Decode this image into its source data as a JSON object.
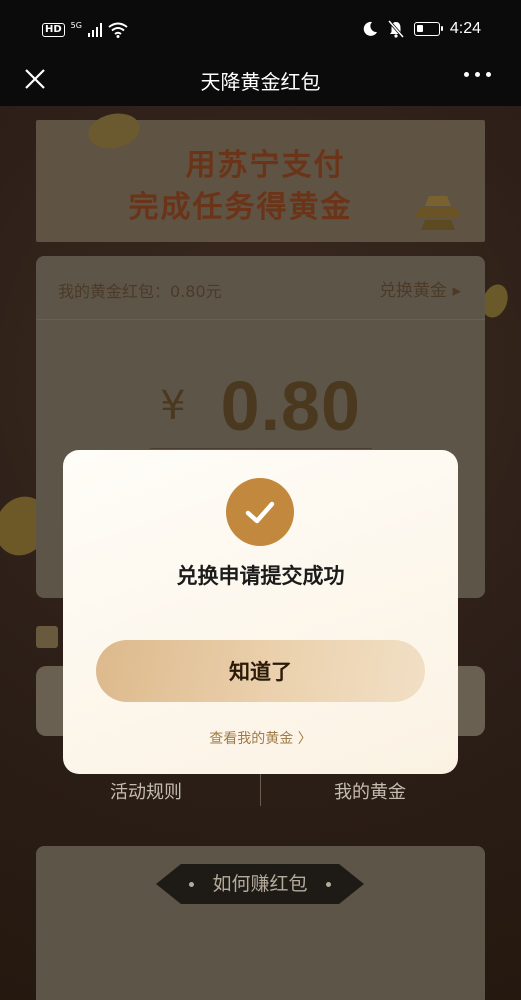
{
  "status_bar": {
    "hd": "HD",
    "network": "5G",
    "time": "4:24"
  },
  "nav": {
    "title": "天降黄金红包"
  },
  "banner": {
    "line1": "用苏宁支付",
    "line2": "完成任务得黄金"
  },
  "card": {
    "balance_label": "我的黄金红包：0.80元",
    "exchange_label": "兑换黄金 ▸",
    "currency": "¥",
    "amount": "0.80"
  },
  "links": {
    "rules": "活动规则",
    "my_gold": "我的黄金"
  },
  "how": {
    "title": "如何赚红包"
  },
  "modal": {
    "title": "兑换申请提交成功",
    "button": "知道了",
    "link": "查看我的黄金 〉"
  },
  "colors": {
    "accent": "#c2893e",
    "button_gradient_start": "#ddb98c",
    "button_gradient_end": "#f1dfc5",
    "link": "#a07a48"
  }
}
